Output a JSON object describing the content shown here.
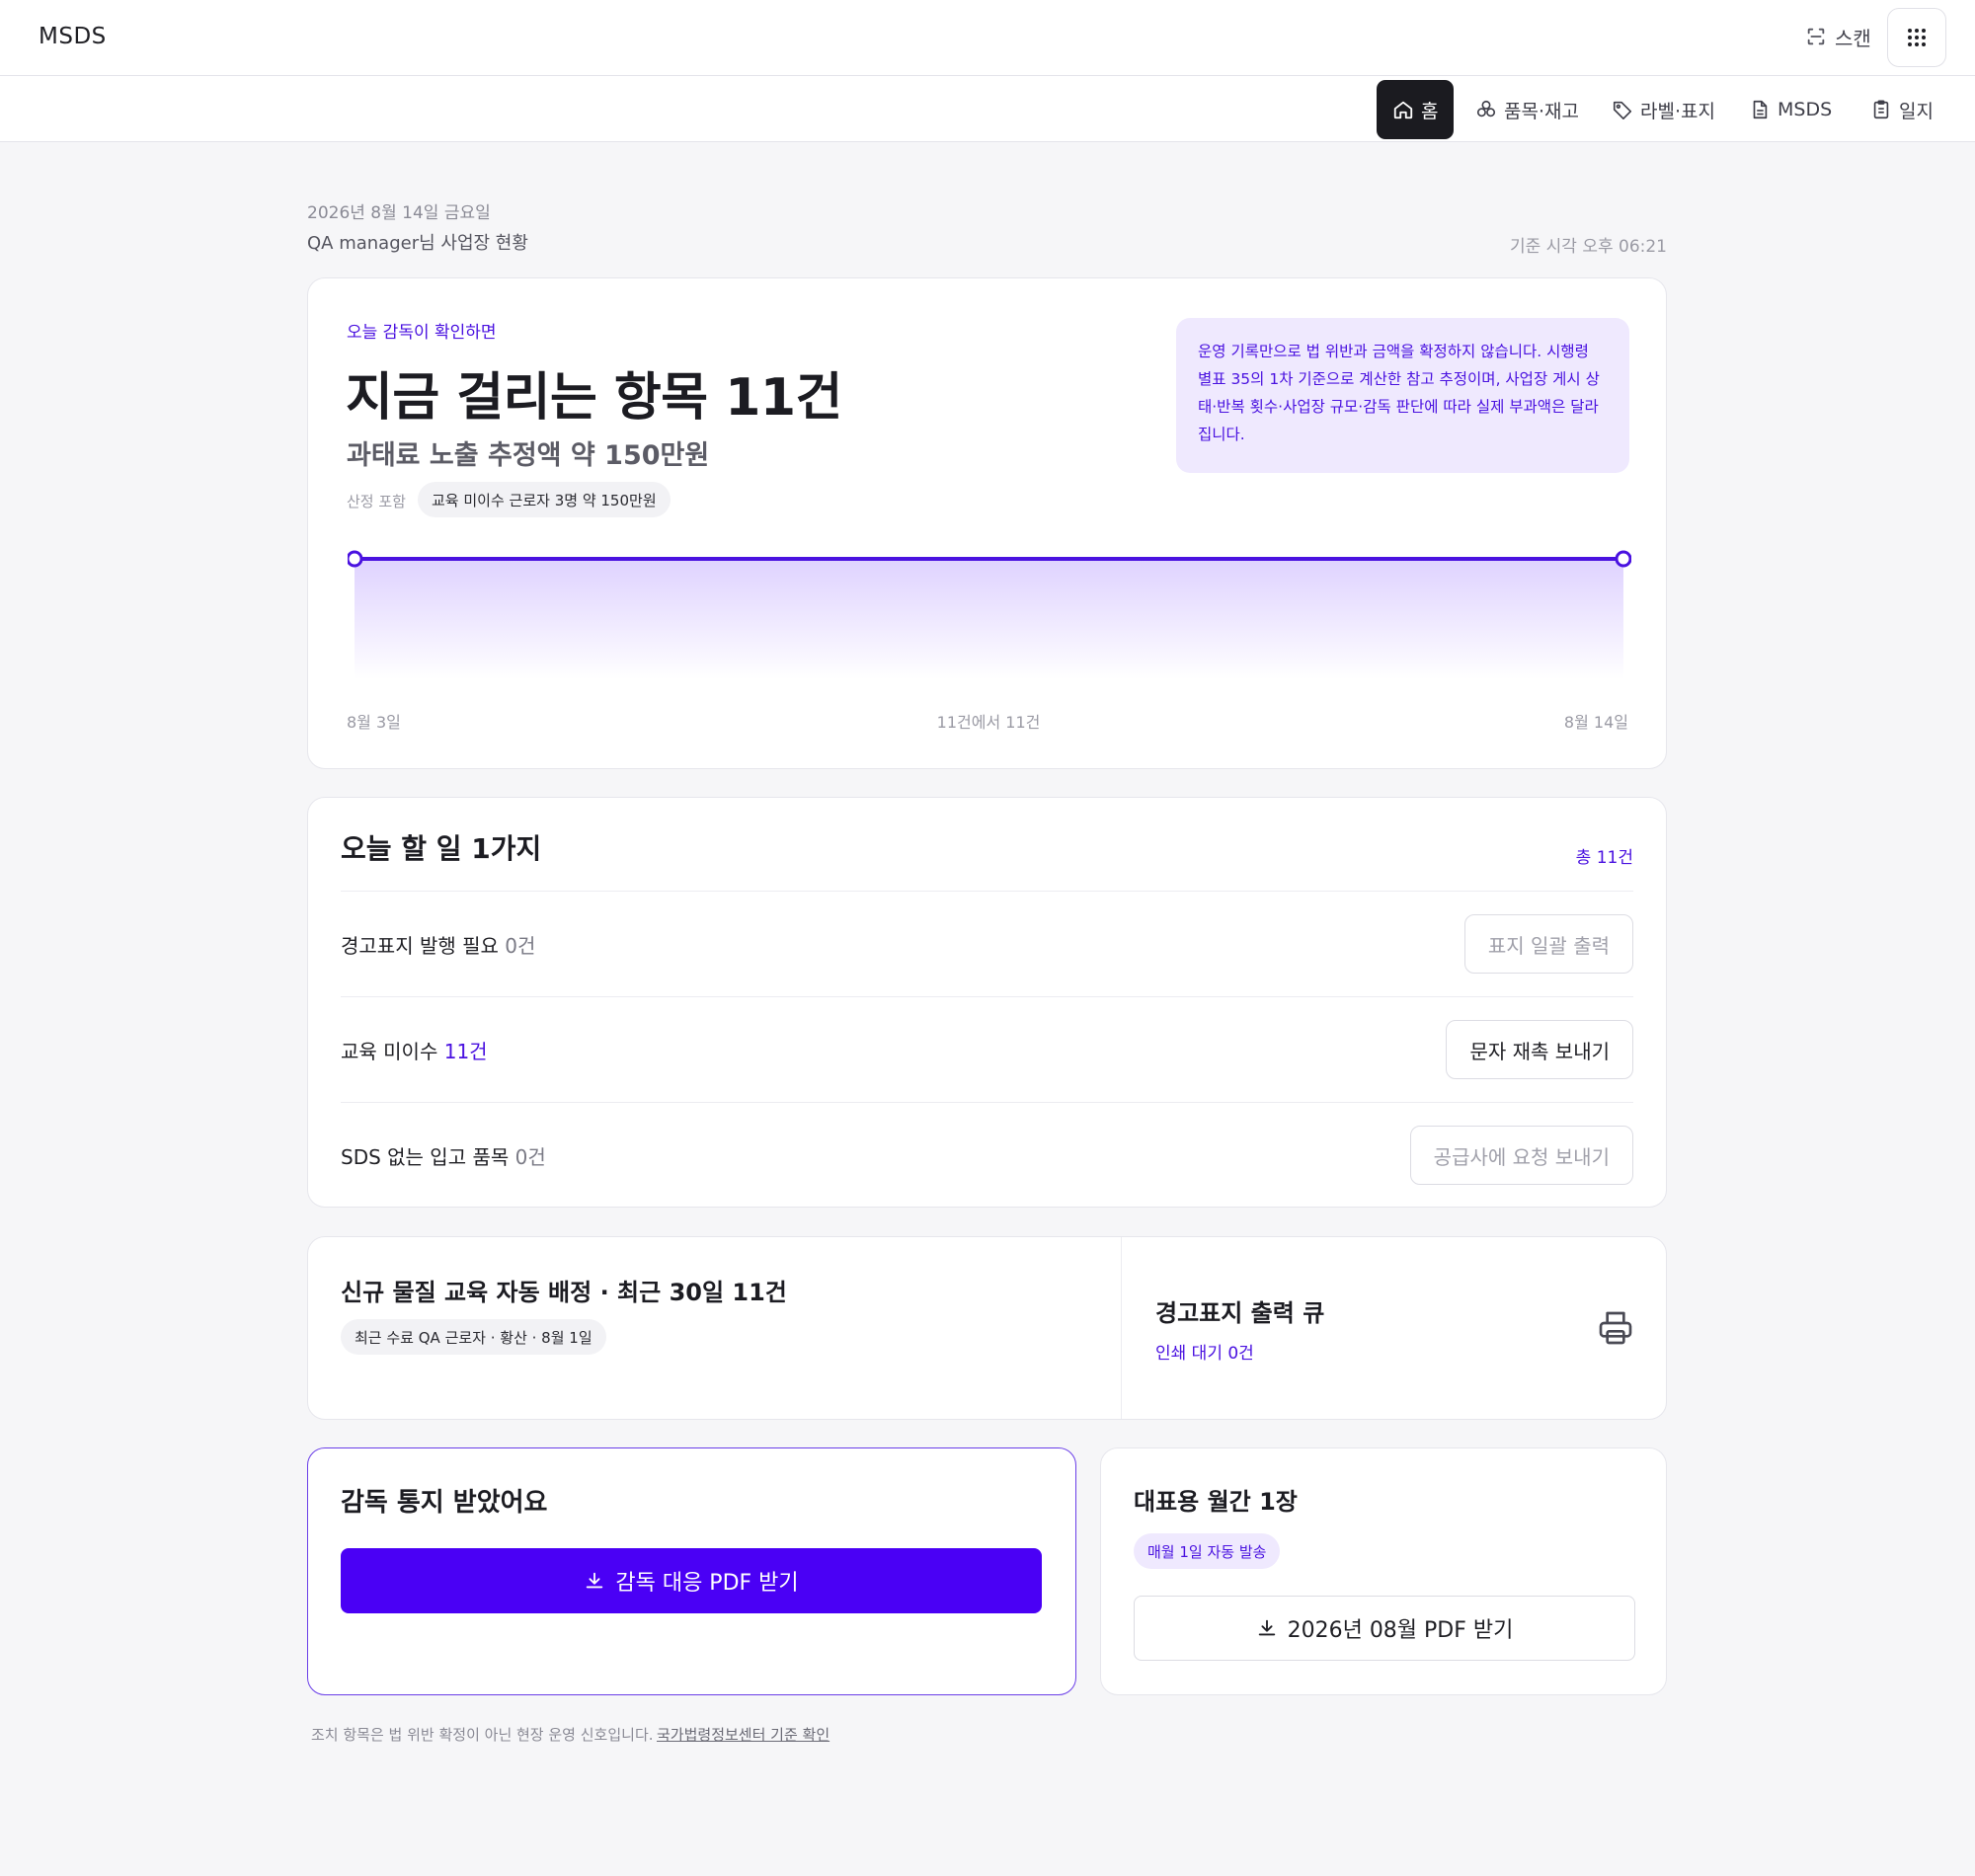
{
  "app": {
    "brand": "MSDS"
  },
  "header": {
    "scan_label": "스캔"
  },
  "nav": {
    "tabs": [
      {
        "label": "홈",
        "icon": "home-icon",
        "active": true
      },
      {
        "label": "품목·재고",
        "icon": "boxes-icon"
      },
      {
        "label": "라벨·표지",
        "icon": "tag-icon"
      },
      {
        "label": "MSDS",
        "icon": "document-icon"
      },
      {
        "label": "일지",
        "icon": "clipboard-icon"
      }
    ]
  },
  "summary": {
    "date": "2026년 8월 14일 금요일",
    "greeting": "QA manager님 사업장 현황",
    "basis_time": "기준 시각 오후 06:21"
  },
  "hero": {
    "kicker": "오늘 감독이 확인하면",
    "title": "지금 걸리는 항목 11건",
    "subtitle": "과태료 노출 추정액 약 150만원",
    "tag_label": "산정 포함",
    "tag": "교육 미이수 근로자 3명 약 150만원",
    "notice": "운영 기록만으로 법 위반과 금액을 확정하지 않습니다. 시행령 별표 35의 1차 기준으로 계산한 참고 추정이며, 사업장 게시 상태·반복 횟수·사업장 규모·감독 판단에 따라 실제 부과액은 달라집니다."
  },
  "chart_data": {
    "type": "area",
    "x": [
      "8월 3일",
      "8월 14일"
    ],
    "series": [
      {
        "values": [
          11,
          11
        ]
      }
    ],
    "center_label": "11건에서 11건",
    "x_start_label": "8월 3일",
    "x_end_label": "8월 14일",
    "line_color": "#4a12e0",
    "fill_color": "#ece4ff"
  },
  "todo": {
    "title": "오늘 할 일 1가지",
    "total": "총 11건",
    "rows": [
      {
        "label": "경고표지 발행 필요 ",
        "count": "0건",
        "button": "표지 일괄 출력",
        "enabled": false
      },
      {
        "label": "교육 미이수 ",
        "count": "11건",
        "button": "문자 재촉 보내기",
        "enabled": true
      },
      {
        "label": "SDS 없는 입고 품목 ",
        "count": "0건",
        "button": "공급사에 요청 보내기",
        "enabled": false
      }
    ]
  },
  "education": {
    "title": "신규 물질 교육 자동 배정 · 최근 30일 11건",
    "recent": "최근 수료 QA 근로자 · 황산 · 8월 1일"
  },
  "print_queue": {
    "title": "경고표지 출력 큐",
    "status": "인쇄 대기 0건"
  },
  "audit": {
    "title": "감독 통지 받았어요",
    "button": "감독 대응 PDF 받기"
  },
  "monthly": {
    "title": "대표용 월간 1장",
    "badge": "매월 1일 자동 발송",
    "button": "2026년 08월 PDF 받기"
  },
  "footer": {
    "note": "조치 항목은 법 위반 확정이 아닌 현장 운영 신호입니다.",
    "link": "국가법령정보센터 기준 확인"
  },
  "colors": {
    "accent": "#4a00f5",
    "accent_text": "#4a12e0",
    "accent_soft": "#efe9fe",
    "active_tab": "#1b1b20"
  }
}
